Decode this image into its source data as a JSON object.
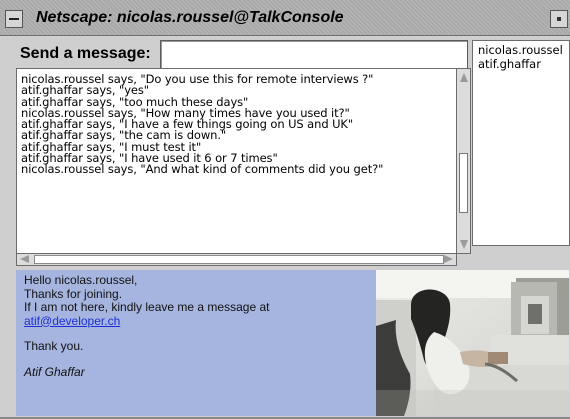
{
  "window": {
    "title": "Netscape: nicolas.roussel@TalkConsole"
  },
  "send": {
    "label": "Send a message:",
    "value": "",
    "placeholder": ""
  },
  "chat": {
    "lines": [
      "nicolas.roussel says, \"Do you use this for remote interviews ?\"",
      "atif.ghaffar says, \"yes\"",
      "atif.ghaffar says, \"too much these days\"",
      "nicolas.roussel says, \"How many times have you used it?\"",
      "atif.ghaffar says, \"I have a few things going on US and UK\"",
      "atif.ghaffar says, \"the cam is down.\"",
      "atif.ghaffar says, \"I must test it\"",
      "atif.ghaffar says, \"I have used it 6 or 7 times\"",
      "nicolas.roussel says, \"And what kind of comments did you get?\""
    ]
  },
  "users": [
    "nicolas.roussel",
    "atif.ghaffar"
  ],
  "message": {
    "line1": "Hello nicolas.roussel,",
    "line2": "Thanks for joining.",
    "line3": "If I am not here, kindly leave me a message at",
    "email": "atif@developer.ch",
    "line4": "Thank you.",
    "signature": "Atif Ghaffar"
  },
  "colors": {
    "panel_blue": "#a6b5df",
    "titlebar_gray": "#a9a9a9"
  },
  "icons": {
    "window_menu": "window-menu-icon",
    "window_control": "window-control-icon",
    "scroll_up": "scroll-up-icon",
    "scroll_down": "scroll-down-icon",
    "scroll_left": "scroll-left-icon",
    "scroll_right": "scroll-right-icon"
  }
}
